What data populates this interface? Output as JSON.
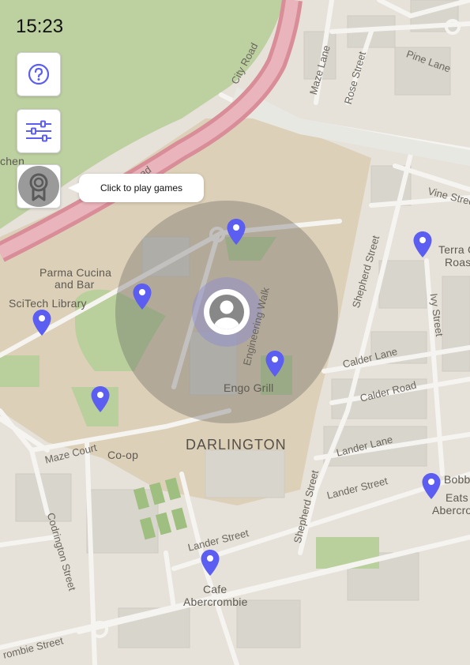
{
  "status_bar": {
    "time": "15:23"
  },
  "controls": {
    "help": {
      "icon": "help-circle-icon"
    },
    "filter": {
      "icon": "sliders-icon"
    },
    "games": {
      "icon": "award-badge-icon",
      "tooltip": "Click to play games"
    }
  },
  "map": {
    "district": "DARLINGTON",
    "places": [
      "Parma Cucina",
      "and Bar",
      "SciTech Library",
      "Engo Grill",
      "Co-op",
      "Cafe",
      "Abercrombie",
      "Terra C",
      "Roast",
      "Bobb",
      "Eats",
      "Abercro",
      "chen"
    ],
    "streets": [
      "City Road",
      "Maze Lane",
      "Rose Street",
      "Pine Lane",
      "Vine Street",
      "Shepherd Street",
      "Ivy Street",
      "Engineering Walk",
      "Calder Lane",
      "Calder Road",
      "Lander Lane",
      "Lander Street",
      "Lander Street",
      "Shepherd Street",
      "Maze Court",
      "Codrington Street",
      "rombie Street",
      "ad"
    ],
    "pin_icon": "map-pin-icon",
    "user_icon": "user-location-icon",
    "colors": {
      "accent": "#5b5ef0",
      "park": "#bdd2a0",
      "road_major": "#d98d98"
    }
  }
}
